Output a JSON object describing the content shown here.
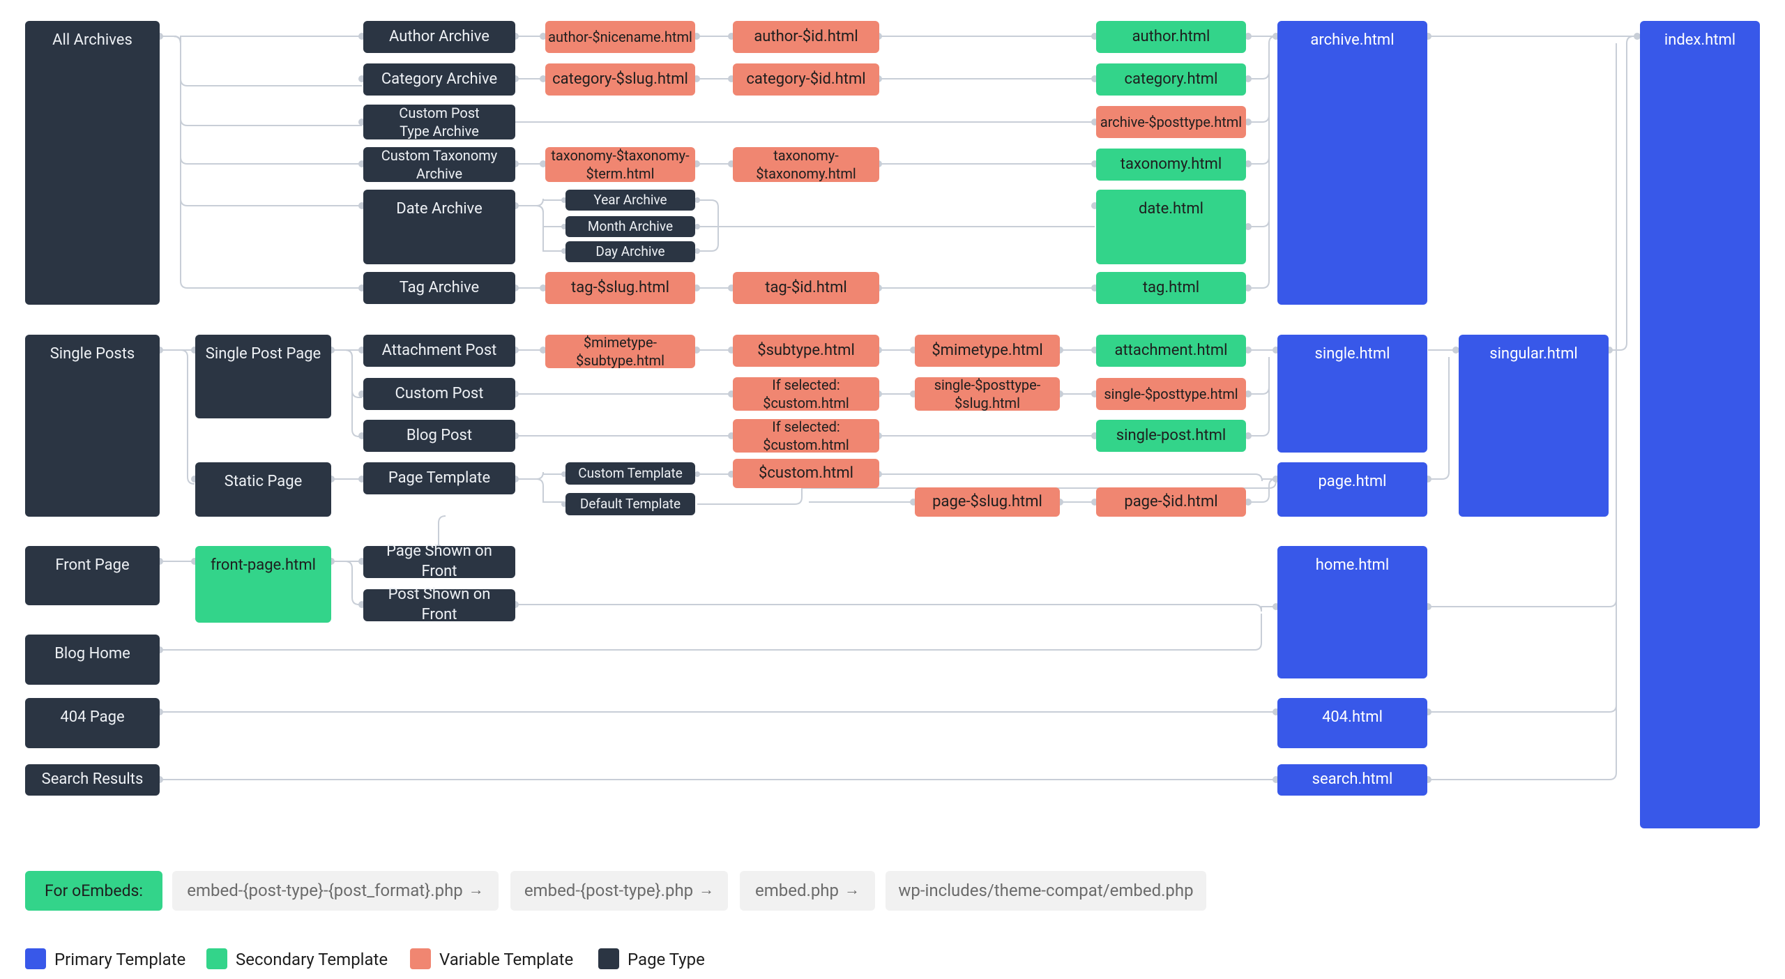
{
  "col0": {
    "all_archives": "All Archives",
    "single_posts": "Single Posts",
    "front_page": "Front Page",
    "blog_home": "Blog Home",
    "404_page": "404 Page",
    "search_results": "Search Results"
  },
  "col1": {
    "single_post_page": "Single Post Page",
    "static_page": "Static Page",
    "front_page_html": "front-page.html"
  },
  "col2": {
    "author_archive": "Author Archive",
    "category_archive": "Category Archive",
    "custom_post_type_archive": "Custom Post\nType Archive",
    "custom_taxonomy_archive": "Custom Taxonomy\nArchive",
    "date_archive": "Date Archive",
    "tag_archive": "Tag Archive",
    "attachment_post": "Attachment Post",
    "custom_post": "Custom Post",
    "blog_post": "Blog Post",
    "page_template": "Page Template",
    "page_shown_front": "Page Shown on Front",
    "post_shown_front": "Post Shown on Front"
  },
  "col3": {
    "author_nicename": "author-$nicename.html",
    "category_slug": "category-$slug.html",
    "taxonomy_term": "taxonomy-$taxonomy-\n$term.html",
    "year_archive": "Year Archive",
    "month_archive": "Month Archive",
    "day_archive": "Day Archive",
    "tag_slug": "tag-$slug.html",
    "mimetype_subtype": "$mimetype-\n$subtype.html",
    "custom_template": "Custom Template",
    "default_template": "Default Template"
  },
  "col4": {
    "author_id": "author-$id.html",
    "category_id": "category-$id.html",
    "taxonomy_taxonomy": "taxonomy-\n$taxonomy.html",
    "tag_id": "tag-$id.html",
    "subtype": "$subtype.html",
    "if_selected_custom": "If selected:\n$custom.html",
    "if_selected_custom2": "If selected:\n$custom.html",
    "custom_html": "$custom.html"
  },
  "col5": {
    "mimetype": "$mimetype.html",
    "single_posttype_slug": "single-$posttype-\n$slug.html",
    "page_slug": "page-$slug.html"
  },
  "col6": {
    "author": "author.html",
    "category": "category.html",
    "archive_posttype": "archive-$posttype.html",
    "taxonomy": "taxonomy.html",
    "date": "date.html",
    "tag": "tag.html",
    "attachment": "attachment.html",
    "single_posttype": "single-$posttype.html",
    "single_post": "single-post.html",
    "page_id": "page-$id.html"
  },
  "col7": {
    "archive": "archive.html",
    "single": "single.html",
    "page": "page.html",
    "home": "home.html",
    "404": "404.html",
    "search": "search.html"
  },
  "col8": {
    "singular": "singular.html"
  },
  "col9": {
    "index": "index.html"
  },
  "embeds": {
    "label": "For oEmbeds:",
    "e1": "embed-{post-type}-{post_format}.php",
    "e2": "embed-{post-type}.php",
    "e3": "embed.php",
    "e4": "wp-includes/theme-compat/embed.php"
  },
  "legend": {
    "primary": "Primary Template",
    "secondary": "Secondary Template",
    "variable": "Variable Template",
    "page_type": "Page Type"
  },
  "colors": {
    "dark": "#2b3543",
    "blue": "#3858e9",
    "green": "#33d48a",
    "orange": "#f08671",
    "grey": "#f1f1f1",
    "wire": "#c8ced7"
  }
}
